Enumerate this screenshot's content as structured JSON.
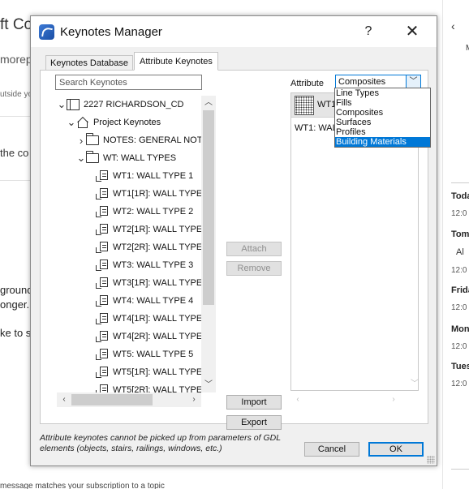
{
  "background": {
    "heading": "ft Co",
    "subheading": "morep",
    "outside_text": "utside yo",
    "line_c": "the co",
    "line_ground": "ground",
    "line_longer": "onger.",
    "line_ke": "ke to s",
    "footer": "message matches your subscription to a topic",
    "right_panel": {
      "back_icon": "chevron-left",
      "items": [
        {
          "label": "Toda",
          "time": "12:0"
        },
        {
          "label": "Tom",
          "sub": "Al",
          "time": "12:0"
        },
        {
          "label": "Frida",
          "time": "12:0"
        },
        {
          "label": "Mon",
          "time": "12:0"
        },
        {
          "label": "Tues",
          "time": "12:0"
        }
      ]
    }
  },
  "dialog": {
    "title": "Keynotes Manager",
    "help_label": "?",
    "close_label": "✕",
    "tabs": [
      "Keynotes Database",
      "Attribute Keynotes"
    ],
    "active_tab": 1,
    "search": {
      "placeholder": "Search Keynotes",
      "value": ""
    },
    "tree": [
      {
        "label": "2227 RICHARDSON_CD",
        "icon": "book",
        "depth": 0,
        "caret": "expanded"
      },
      {
        "label": "Project Keynotes",
        "icon": "project",
        "depth": 1,
        "caret": "expanded"
      },
      {
        "label": "NOTES: GENERAL NOT",
        "icon": "folder",
        "depth": 2,
        "caret": "collapsed"
      },
      {
        "label": "WT: WALL TYPES",
        "icon": "folder",
        "depth": 2,
        "caret": "expanded"
      },
      {
        "label": "WT1: WALL TYPE 1",
        "icon": "doc",
        "depth": 3,
        "caret": ""
      },
      {
        "label": "WT1[1R]: WALL TYPE",
        "icon": "doc",
        "depth": 3,
        "caret": ""
      },
      {
        "label": "WT2: WALL TYPE 2",
        "icon": "doc",
        "depth": 3,
        "caret": ""
      },
      {
        "label": "WT2[1R]: WALL TYPE",
        "icon": "doc",
        "depth": 3,
        "caret": ""
      },
      {
        "label": "WT2[2R]: WALL TYPE",
        "icon": "doc",
        "depth": 3,
        "caret": ""
      },
      {
        "label": "WT3: WALL TYPE 3",
        "icon": "doc",
        "depth": 3,
        "caret": ""
      },
      {
        "label": "WT3[1R]: WALL TYPE",
        "icon": "doc",
        "depth": 3,
        "caret": ""
      },
      {
        "label": "WT4: WALL TYPE 4",
        "icon": "doc",
        "depth": 3,
        "caret": ""
      },
      {
        "label": "WT4[1R]: WALL TYPE",
        "icon": "doc",
        "depth": 3,
        "caret": ""
      },
      {
        "label": "WT4[2R]: WALL TYPE",
        "icon": "doc",
        "depth": 3,
        "caret": ""
      },
      {
        "label": "WT5: WALL TYPE 5",
        "icon": "doc",
        "depth": 3,
        "caret": ""
      },
      {
        "label": "WT5[1R]: WALL TYPE",
        "icon": "doc",
        "depth": 3,
        "caret": ""
      },
      {
        "label": "WT5[2R]: WALL TYPE",
        "icon": "doc",
        "depth": 3,
        "caret": ""
      }
    ],
    "buttons": {
      "attach": "Attach",
      "remove": "Remove",
      "import": "Import",
      "export": "Export",
      "cancel": "Cancel",
      "ok": "OK"
    },
    "attribute": {
      "label": "Attribute",
      "selected": "Composites",
      "header_text": "WT1",
      "list_item": "WT1: WAL",
      "options": [
        "Line Types",
        "Fills",
        "Composites",
        "Surfaces",
        "Profiles",
        "Building Materials"
      ],
      "highlighted_option": "Building Materials"
    },
    "note": "Attribute keynotes cannot be picked up from parameters of GDL elements (objects, stairs, railings, windows, etc.)",
    "colors": {
      "accent": "#0078d7",
      "disabled_text": "#8f8f8f"
    }
  }
}
